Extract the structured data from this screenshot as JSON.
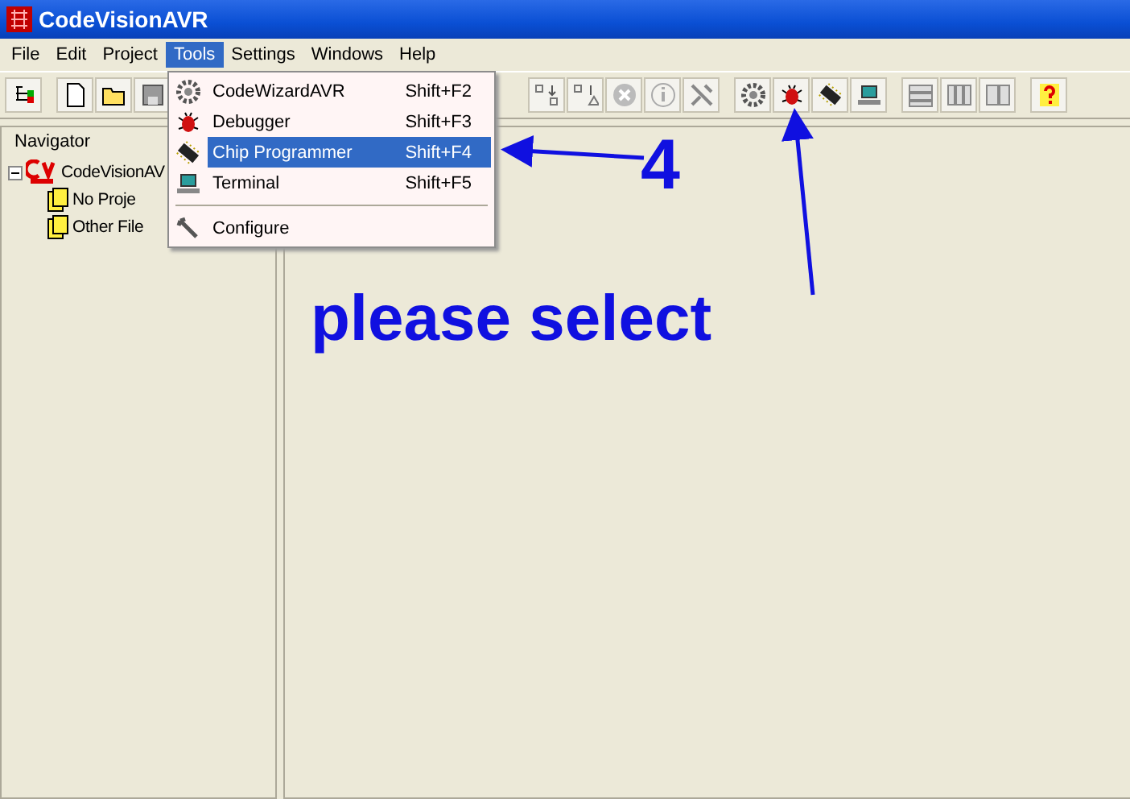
{
  "window": {
    "title": "CodeVisionAVR"
  },
  "menu_bar": [
    {
      "label": "File",
      "selected": false
    },
    {
      "label": "Edit",
      "selected": false
    },
    {
      "label": "Project",
      "selected": false
    },
    {
      "label": "Tools",
      "selected": true
    },
    {
      "label": "Settings",
      "selected": false
    },
    {
      "label": "Windows",
      "selected": false
    },
    {
      "label": "Help",
      "selected": false
    }
  ],
  "navigator": {
    "title": "Navigator",
    "tree": [
      {
        "label": "CodeVisionAV",
        "expanded": true,
        "children": [
          {
            "label": "No Proje"
          },
          {
            "label": "Other File"
          }
        ]
      }
    ]
  },
  "tools_menu": [
    {
      "kind": "item",
      "label": "CodeWizardAVR",
      "shortcut": "Shift+F2",
      "selected": false
    },
    {
      "kind": "item",
      "label": "Debugger",
      "shortcut": "Shift+F3",
      "selected": false
    },
    {
      "kind": "item",
      "label": "Chip Programmer",
      "shortcut": "Shift+F4",
      "selected": true
    },
    {
      "kind": "item",
      "label": "Terminal",
      "shortcut": "Shift+F5",
      "selected": false
    },
    {
      "kind": "separator"
    },
    {
      "kind": "item",
      "label": "Configure",
      "selected": false
    }
  ],
  "annotations": {
    "step": "4",
    "instruction": "please select"
  }
}
